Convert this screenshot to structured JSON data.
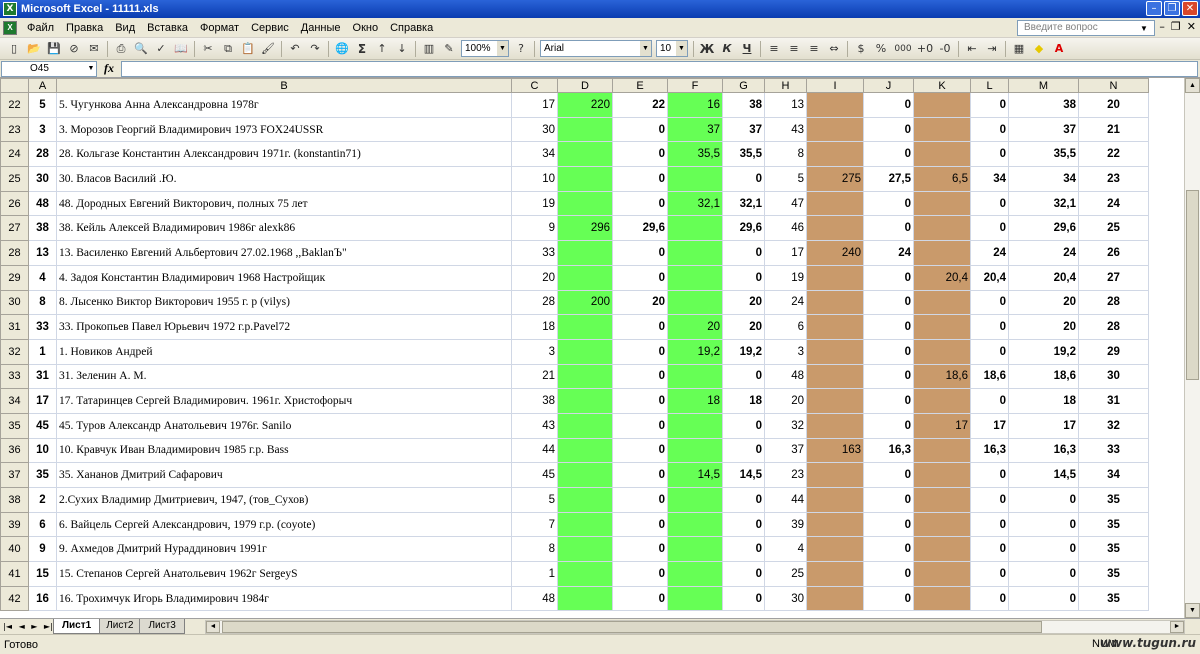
{
  "window": {
    "title": "Microsoft Excel - 11111.xls"
  },
  "menu": {
    "items": [
      "Файл",
      "Правка",
      "Вид",
      "Вставка",
      "Формат",
      "Сервис",
      "Данные",
      "Окно",
      "Справка"
    ],
    "help_placeholder": "Введите вопрос"
  },
  "toolbar": {
    "zoom": "100%",
    "font_name": "Arial",
    "font_size": "10",
    "bold_label": "Ж",
    "italic_label": "К",
    "underline_label": "Ч",
    "percent_label": "%",
    "thousands_label": "000",
    "autosum_label": "Σ"
  },
  "formula_bar": {
    "name_box": "O45",
    "fx_label": "fx",
    "formula": ""
  },
  "columns": [
    "A",
    "B",
    "C",
    "D",
    "E",
    "F",
    "G",
    "H",
    "I",
    "J",
    "K",
    "L",
    "M",
    "N"
  ],
  "rows": [
    {
      "r": "22",
      "a": "5",
      "b": "5. Чугункова Анна Александровна 1978г",
      "c": "17",
      "d": "220",
      "e": "22",
      "f": "16",
      "g": "38",
      "h": "13",
      "i": "",
      "j": "0",
      "k": "",
      "l": "0",
      "m": "38",
      "n": "20"
    },
    {
      "r": "23",
      "a": "3",
      "b": "3. Морозов Георгий Владимирович 1973 FOX24USSR",
      "c": "30",
      "d": "",
      "e": "0",
      "f": "37",
      "g": "37",
      "h": "43",
      "i": "",
      "j": "0",
      "k": "",
      "l": "0",
      "m": "37",
      "n": "21"
    },
    {
      "r": "24",
      "a": "28",
      "b": "28. Кольгазе Константин Александрович 1971г. (konstantin71)",
      "c": "34",
      "d": "",
      "e": "0",
      "f": "35,5",
      "g": "35,5",
      "h": "8",
      "i": "",
      "j": "0",
      "k": "",
      "l": "0",
      "m": "35,5",
      "n": "22"
    },
    {
      "r": "25",
      "a": "30",
      "b": "30. Власов Василий .Ю.",
      "c": "10",
      "d": "",
      "e": "0",
      "f": "",
      "g": "0",
      "h": "5",
      "i": "275",
      "j": "27,5",
      "k": "6,5",
      "l": "34",
      "m": "34",
      "n": "23"
    },
    {
      "r": "26",
      "a": "48",
      "b": "48. Дородных Евгений Викторович, полных 75 лет",
      "c": "19",
      "d": "",
      "e": "0",
      "f": "32,1",
      "g": "32,1",
      "h": "47",
      "i": "",
      "j": "0",
      "k": "",
      "l": "0",
      "m": "32,1",
      "n": "24"
    },
    {
      "r": "27",
      "a": "38",
      "b": "38. Кейль Алексей Владимирович 1986г alexk86",
      "c": "9",
      "d": "296",
      "e": "29,6",
      "f": "",
      "g": "29,6",
      "h": "46",
      "i": "",
      "j": "0",
      "k": "",
      "l": "0",
      "m": "29,6",
      "n": "25"
    },
    {
      "r": "28",
      "a": "13",
      "b": "13. Василенко Евгений Альбертович 27.02.1968 ,,BaklanЪ\"",
      "c": "33",
      "d": "",
      "e": "0",
      "f": "",
      "g": "0",
      "h": "17",
      "i": "240",
      "j": "24",
      "k": "",
      "l": "24",
      "m": "24",
      "n": "26"
    },
    {
      "r": "29",
      "a": "4",
      "b": "4. Задоя Константин Владимирович 1968 Настройщик",
      "c": "20",
      "d": "",
      "e": "0",
      "f": "",
      "g": "0",
      "h": "19",
      "i": "",
      "j": "0",
      "k": "20,4",
      "l": "20,4",
      "m": "20,4",
      "n": "27"
    },
    {
      "r": "30",
      "a": "8",
      "b": "8. Лысенко Виктор Викторович 1955 г. р (vilys)",
      "c": "28",
      "d": "200",
      "e": "20",
      "f": "",
      "g": "20",
      "h": "24",
      "i": "",
      "j": "0",
      "k": "",
      "l": "0",
      "m": "20",
      "n": "28"
    },
    {
      "r": "31",
      "a": "33",
      "b": "33. Прокопьев Павел Юрьевич 1972 г.р.Pavel72",
      "c": "18",
      "d": "",
      "e": "0",
      "f": "20",
      "g": "20",
      "h": "6",
      "i": "",
      "j": "0",
      "k": "",
      "l": "0",
      "m": "20",
      "n": "28"
    },
    {
      "r": "32",
      "a": "1",
      "b": "1. Новиков Андрей",
      "c": "3",
      "d": "",
      "e": "0",
      "f": "19,2",
      "g": "19,2",
      "h": "3",
      "i": "",
      "j": "0",
      "k": "",
      "l": "0",
      "m": "19,2",
      "n": "29"
    },
    {
      "r": "33",
      "a": "31",
      "b": "31. Зеленин А. М.",
      "c": "21",
      "d": "",
      "e": "0",
      "f": "",
      "g": "0",
      "h": "48",
      "i": "",
      "j": "0",
      "k": "18,6",
      "l": "18,6",
      "m": "18,6",
      "n": "30"
    },
    {
      "r": "34",
      "a": "17",
      "b": "17. Татаринцев Сергей Владимирович. 1961г. Христофорыч",
      "c": "38",
      "d": "",
      "e": "0",
      "f": "18",
      "g": "18",
      "h": "20",
      "i": "",
      "j": "0",
      "k": "",
      "l": "0",
      "m": "18",
      "n": "31"
    },
    {
      "r": "35",
      "a": "45",
      "b": "45. Туров Александр Анатольевич 1976г. Sanilo",
      "c": "43",
      "d": "",
      "e": "0",
      "f": "",
      "g": "0",
      "h": "32",
      "i": "",
      "j": "0",
      "k": "17",
      "l": "17",
      "m": "17",
      "n": "32"
    },
    {
      "r": "36",
      "a": "10",
      "b": "10. Кравчук Иван Владимирович 1985 г.р. Bass",
      "c": "44",
      "d": "",
      "e": "0",
      "f": "",
      "g": "0",
      "h": "37",
      "i": "163",
      "j": "16,3",
      "k": "",
      "l": "16,3",
      "m": "16,3",
      "n": "33"
    },
    {
      "r": "37",
      "a": "35",
      "b": "35. Хананов Дмитрий Сафарович",
      "c": "45",
      "d": "",
      "e": "0",
      "f": "14,5",
      "g": "14,5",
      "h": "23",
      "i": "",
      "j": "0",
      "k": "",
      "l": "0",
      "m": "14,5",
      "n": "34"
    },
    {
      "r": "38",
      "a": "2",
      "b": "2.Сухих Владимир Дмитриевич, 1947, (тов_Сухов)",
      "c": "5",
      "d": "",
      "e": "0",
      "f": "",
      "g": "0",
      "h": "44",
      "i": "",
      "j": "0",
      "k": "",
      "l": "0",
      "m": "0",
      "n": "35"
    },
    {
      "r": "39",
      "a": "6",
      "b": "6. Вайцель Сергей Александрович, 1979 г.р. (coyote)",
      "c": "7",
      "d": "",
      "e": "0",
      "f": "",
      "g": "0",
      "h": "39",
      "i": "",
      "j": "0",
      "k": "",
      "l": "0",
      "m": "0",
      "n": "35"
    },
    {
      "r": "40",
      "a": "9",
      "b": "9. Ахмедов Дмитрий Нураддинович 1991г",
      "c": "8",
      "d": "",
      "e": "0",
      "f": "",
      "g": "0",
      "h": "4",
      "i": "",
      "j": "0",
      "k": "",
      "l": "0",
      "m": "0",
      "n": "35"
    },
    {
      "r": "41",
      "a": "15",
      "b": "15. Степанов Сергей Анатольевич 1962г SergeyS",
      "c": "1",
      "d": "",
      "e": "0",
      "f": "",
      "g": "0",
      "h": "25",
      "i": "",
      "j": "0",
      "k": "",
      "l": "0",
      "m": "0",
      "n": "35"
    },
    {
      "r": "42",
      "a": "16",
      "b": "16. Трохимчук Игорь Владимирович 1984г",
      "c": "48",
      "d": "",
      "e": "0",
      "f": "",
      "g": "0",
      "h": "30",
      "i": "",
      "j": "0",
      "k": "",
      "l": "0",
      "m": "0",
      "n": "35"
    }
  ],
  "sheet_tabs": [
    "Лист1",
    "Лист2",
    "Лист3"
  ],
  "status": {
    "ready": "Готово",
    "num_indicator": "NUM",
    "watermark": "www.tugun.ru"
  },
  "colors": {
    "green_column": "#66ff55",
    "brown_column": "#c99a6b",
    "titlebar": "#0a3cb0"
  }
}
